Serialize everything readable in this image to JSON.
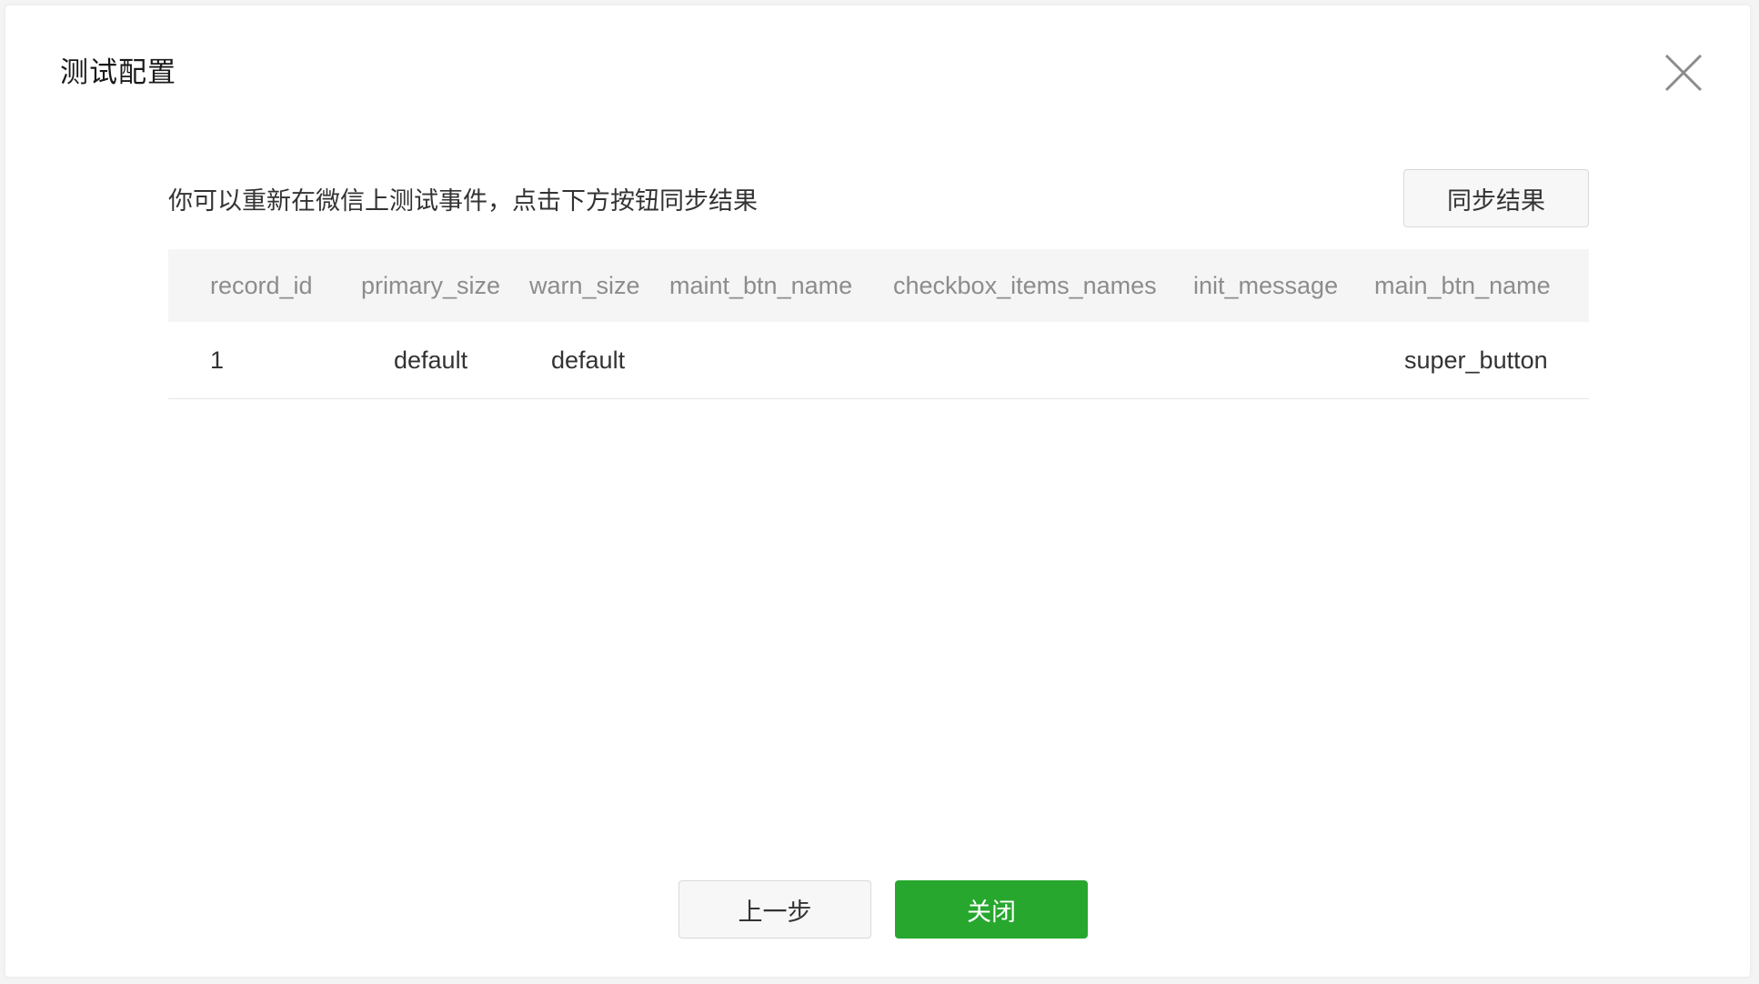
{
  "dialog": {
    "title": "测试配置",
    "close_icon": "close-icon"
  },
  "instruction": "你可以重新在微信上测试事件，点击下方按钮同步结果",
  "sync_button": "同步结果",
  "table": {
    "columns": [
      "record_id",
      "primary_size",
      "warn_size",
      "maint_btn_name",
      "checkbox_items_names",
      "init_message",
      "main_btn_name"
    ],
    "rows": [
      [
        "1",
        "default",
        "default",
        "",
        "",
        "",
        "super_button"
      ]
    ]
  },
  "footer": {
    "prev_label": "上一步",
    "close_label": "关闭"
  },
  "colors": {
    "primary": "#27a72e",
    "header_bg": "#f5f5f5"
  }
}
